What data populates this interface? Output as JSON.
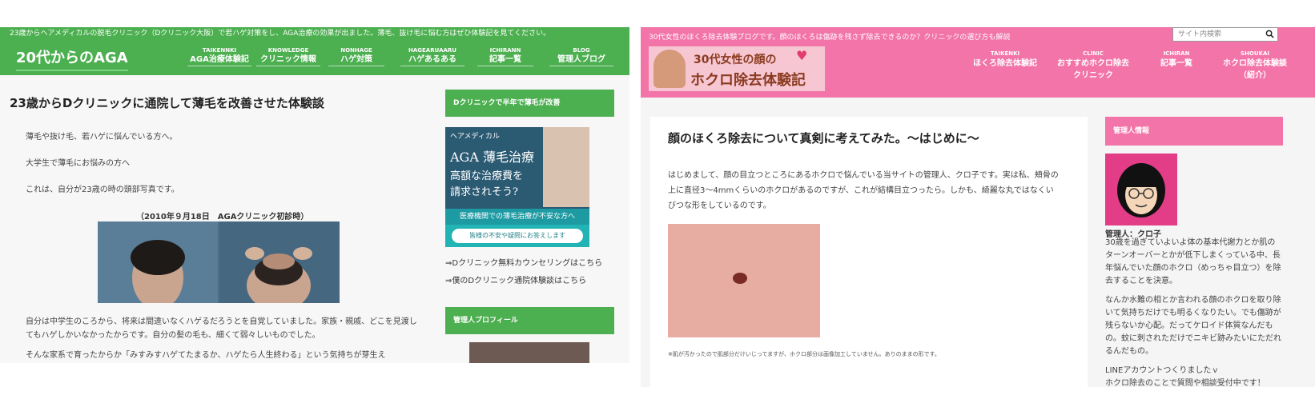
{
  "left_site": {
    "topbar_text": "23歳からヘアメディカルの脱毛クリニック（Dクリニック大阪）で若ハゲ対策をし、AGA治療の効果が出ました。薄毛、抜け毛に悩む方はぜひ体験記を見てください。",
    "logo": "20代からのAGA",
    "nav": [
      {
        "en": "TAIKENNKI",
        "jp": "AGA治療体験記"
      },
      {
        "en": "KNOWLEDGE",
        "jp": "クリニック情報"
      },
      {
        "en": "NONHAGE",
        "jp": "ハゲ対策"
      },
      {
        "en": "HAGEARUAARU",
        "jp": "ハゲあるある"
      },
      {
        "en": "ICHIRANN",
        "jp": "記事一覧"
      },
      {
        "en": "BLOG",
        "jp": "管理人ブログ"
      }
    ],
    "article": {
      "title": "23歳からDクリニックに通院して薄毛を改善させた体験談",
      "lines": [
        "薄毛や抜け毛、若ハゲに悩んでいる方へ。",
        "大学生で薄毛にお悩みの方へ",
        "これは、自分が23歳の時の頭部写真です。"
      ],
      "caption": "（2010年９月18日　AGAクリニック初診時）",
      "body": "自分は中学生のころから、将来は間違いなくハゲるだろうとを自覚していました。家族・親戚、どこを見渡してもハゲしかいなかったからです。自分の髪の毛も、細くて弱々しいものでした。",
      "body_cut": "そんな家系で育ったからか「みすみすハゲてたまるか、ハゲたら人生終わる」という気持ちが芽生え"
    },
    "sidebar": {
      "widget1_title": "Dクリニックで半年で薄毛が改善",
      "banner": {
        "brand": "ヘアメディカル",
        "title": "AGA 薄毛治療",
        "sub_lines": [
          "高額な治療費を",
          "請求されそう?"
        ],
        "strip": "医療機関での薄毛治療が不安な方へ",
        "button": "皆様の不安や疑問にお答えします"
      },
      "links": [
        "⇒Dクリニック無料カウンセリングはこちら",
        "⇒僕のDクリニック通院体験談はこちら"
      ],
      "widget2_title": "管理人プロフィール"
    }
  },
  "right_site": {
    "topline": "30代女性のほくろ除去体験ブログです。顔のほくろは傷跡を残さず除去できるのか？クリニックの選び方も解説",
    "search_placeholder": "サイト内検索",
    "logo_lines": [
      "30代女性の顔の",
      "ホクロ除去体験記"
    ],
    "nav": [
      {
        "en": "TAIKENKI",
        "jp": "ほくろ除去体験記"
      },
      {
        "en": "CLINIC",
        "jp": "おすすめホクロ除去クリニック"
      },
      {
        "en": "ICHIRAN",
        "jp": "記事一覧"
      },
      {
        "en": "SHOUKAI",
        "jp": "ホクロ除去体験談（紹介）"
      }
    ],
    "article": {
      "title": "顔のほくろ除去について真剣に考えてみた。〜はじめに〜",
      "intro": "はじめまして、顔の目立つところにあるホクロで悩んでいる当サイトの管理人、クロ子です。実は私、頬骨の上に直径3〜4mmくらいのホクロがあるのですが、これが結構目立つったら。しかも、綺麗な丸ではなくいびつな形をしているのです。",
      "note": "※肌が汚かったので肌部分だけいじってますが、ホクロ部分は画像加工していません。ありのままの形です。"
    },
    "sidebar": {
      "widget_title": "管理人情報",
      "name": "管理人：クロ子",
      "bio": [
        "30歳を過ぎていよいよ体の基本代謝力とか肌のターンオーバーとかが低下しまくっている中、長年悩んでいた顔のホクロ（めっちゃ目立つ）を除去することを決意。",
        "なんか水難の相とか言われる顔のホクロを取り除いて気持ちだけでも明るくなりたい。でも傷跡が残らないか心配。だってケロイド体質なんだもの。蚊に刺されただけでニキビ跡みたいにただれるんだもの。",
        "LINEアカウントつくりましたｖ",
        "ホクロ除去のことで質問や相談受付中です！"
      ]
    }
  },
  "colors": {
    "left_accent": "#4caf50",
    "right_accent": "#f274a8"
  }
}
